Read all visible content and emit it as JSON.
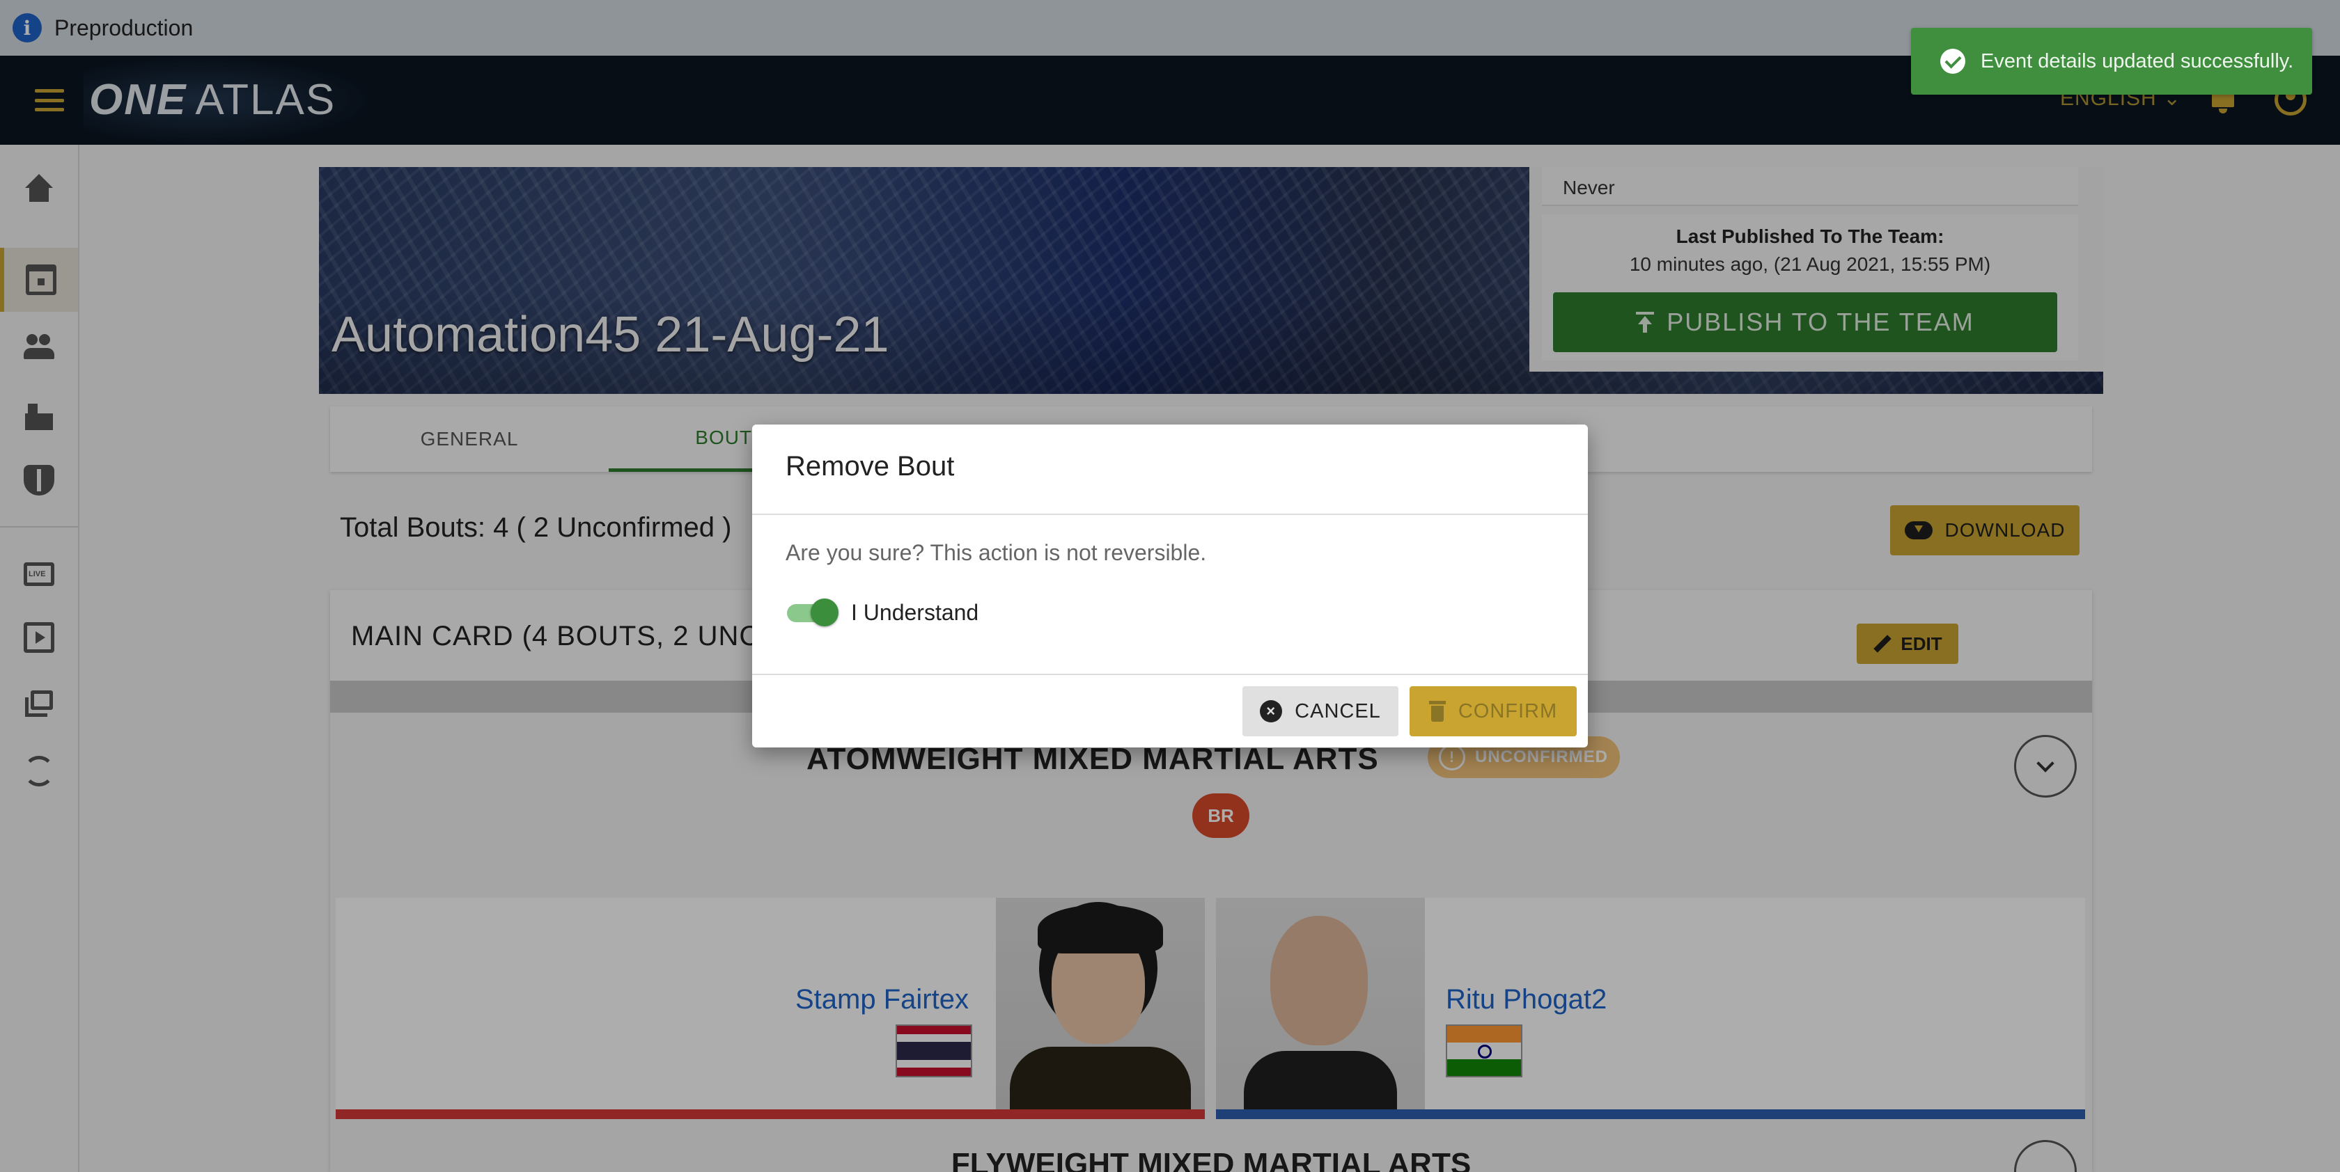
{
  "env_bar": {
    "label": "Preproduction",
    "icon": "info-icon"
  },
  "topnav": {
    "brand_one": "ONE",
    "brand_atlas": "ATLAS",
    "language": "ENGLISH",
    "language_icon": "chevron-down-icon",
    "notifications_icon": "bell-icon",
    "account_icon": "account-circle-icon",
    "menu_icon": "menu-icon",
    "accent_color": "#c9a431"
  },
  "sidebar": {
    "items": [
      {
        "name": "home",
        "icon": "home-icon"
      },
      {
        "name": "events",
        "icon": "calendar-icon",
        "active": true
      },
      {
        "name": "athletes",
        "icon": "people-icon"
      },
      {
        "name": "venues",
        "icon": "building-icon"
      },
      {
        "name": "teams",
        "icon": "shield-icon"
      },
      {
        "name": "live",
        "icon": "live-tv-icon"
      },
      {
        "name": "videos",
        "icon": "video-library-icon"
      },
      {
        "name": "galleries",
        "icon": "gallery-icon"
      },
      {
        "name": "sync",
        "icon": "sync-icon"
      }
    ]
  },
  "event": {
    "title": "Automation45 21-Aug-21",
    "last_published_never": "Never",
    "last_published_label": "Last Published To The Team:",
    "last_published_time": "10 minutes ago, (21 Aug 2021, 15:55 PM)",
    "publish_button": "PUBLISH TO THE TEAM"
  },
  "tabs": [
    {
      "label": "GENERAL"
    },
    {
      "label": "BOUTS",
      "active": true
    }
  ],
  "bouts": {
    "total_text": "Total Bouts: 4 ( 2 Unconfirmed )",
    "download_label": "DOWNLOAD",
    "card_title": "MAIN CARD (4 BOUTS, 2 UNCONFIRMED)",
    "edit_label": "EDIT",
    "bout1": {
      "title": "ATOMWEIGHT MIXED MARTIAL ARTS",
      "status": "UNCONFIRMED",
      "badge": "BR",
      "red_corner": {
        "name": "Stamp Fairtex",
        "country": "Thailand"
      },
      "blue_corner": {
        "name": "Ritu Phogat2",
        "country": "India"
      }
    },
    "bout2_title": "FLYWEIGHT MIXED MARTIAL ARTS"
  },
  "dialog": {
    "title": "Remove Bout",
    "message": "Are you sure? This action is not reversible.",
    "toggle_label": "I Understand",
    "toggle_on": true,
    "cancel_label": "CANCEL",
    "confirm_label": "CONFIRM"
  },
  "toast": {
    "message": "Event details updated successfully.",
    "color": "#3f8f3f"
  }
}
